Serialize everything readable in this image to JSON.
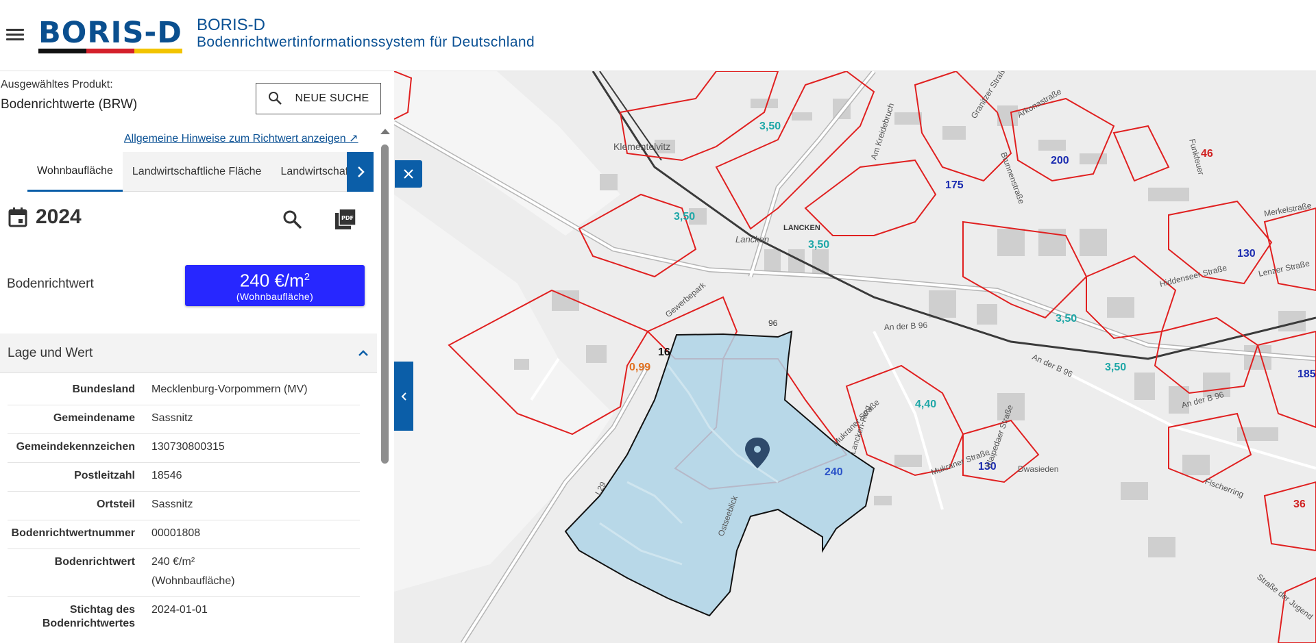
{
  "header": {
    "logo": "BORIS-D",
    "title": "BORIS-D",
    "subtitle": "Bodenrichtwertinformationssystem für Deutschland"
  },
  "product": {
    "label": "Ausgewähltes Produkt:",
    "value": "Bodenrichtwerte (BRW)",
    "new_search": "NEUE SUCHE"
  },
  "hint_link": "Allgemeine Hinweise zum Richtwert anzeigen ↗",
  "tabs": [
    "Wohnbaufläche",
    "Landwirtschaftliche Fläche",
    "Landwirtschaf"
  ],
  "year": "2024",
  "brw": {
    "label": "Bodenrichtwert",
    "value": "240 €/m",
    "sup": "2",
    "usage": "(Wohnbaufläche)"
  },
  "section_title": "Lage und Wert",
  "details": [
    {
      "key": "Bundesland",
      "value": "Mecklenburg-Vorpommern (MV)"
    },
    {
      "key": "Gemeindename",
      "value": "Sassnitz"
    },
    {
      "key": "Gemeindekennzeichen",
      "value": "130730800315"
    },
    {
      "key": "Postleitzahl",
      "value": "18546"
    },
    {
      "key": "Ortsteil",
      "value": "Sassnitz"
    },
    {
      "key": "Bodenrichtwertnummer",
      "value": "00001808"
    },
    {
      "key": "Bodenrichtwert",
      "value": "240 €/m²",
      "value2": "(Wohnbaufläche)"
    },
    {
      "key": "Stichtag des Bodenrichtwertes",
      "value": "2024-01-01"
    }
  ],
  "map": {
    "zone_labels": [
      "3,50",
      "3,50",
      "3,50",
      "3,50",
      "3,50",
      "4,40",
      "0,99",
      "16",
      "46",
      "36",
      "200",
      "175",
      "130",
      "130",
      "185",
      "240"
    ],
    "place_labels": [
      "Klementelvitz",
      "LANCKEN",
      "Lancken",
      "Gewerbepark",
      "Am Kreidebruch",
      "Granitzer Straße",
      "Arkonastraße",
      "Brunnenstraße",
      "Funkfeuer",
      "Merkelstraße",
      "Lenzer Straße",
      "Hiddenseer Straße",
      "An der B 96",
      "An der B 96",
      "An der B 96",
      "Lancken-Ring",
      "Mukraner Straße",
      "Mukraner Straße",
      "Ostseeblick",
      "Klaipedaer Straße",
      "Dwasieden",
      "Fischerring",
      "Straße der Jugend",
      "L29",
      "96"
    ]
  }
}
